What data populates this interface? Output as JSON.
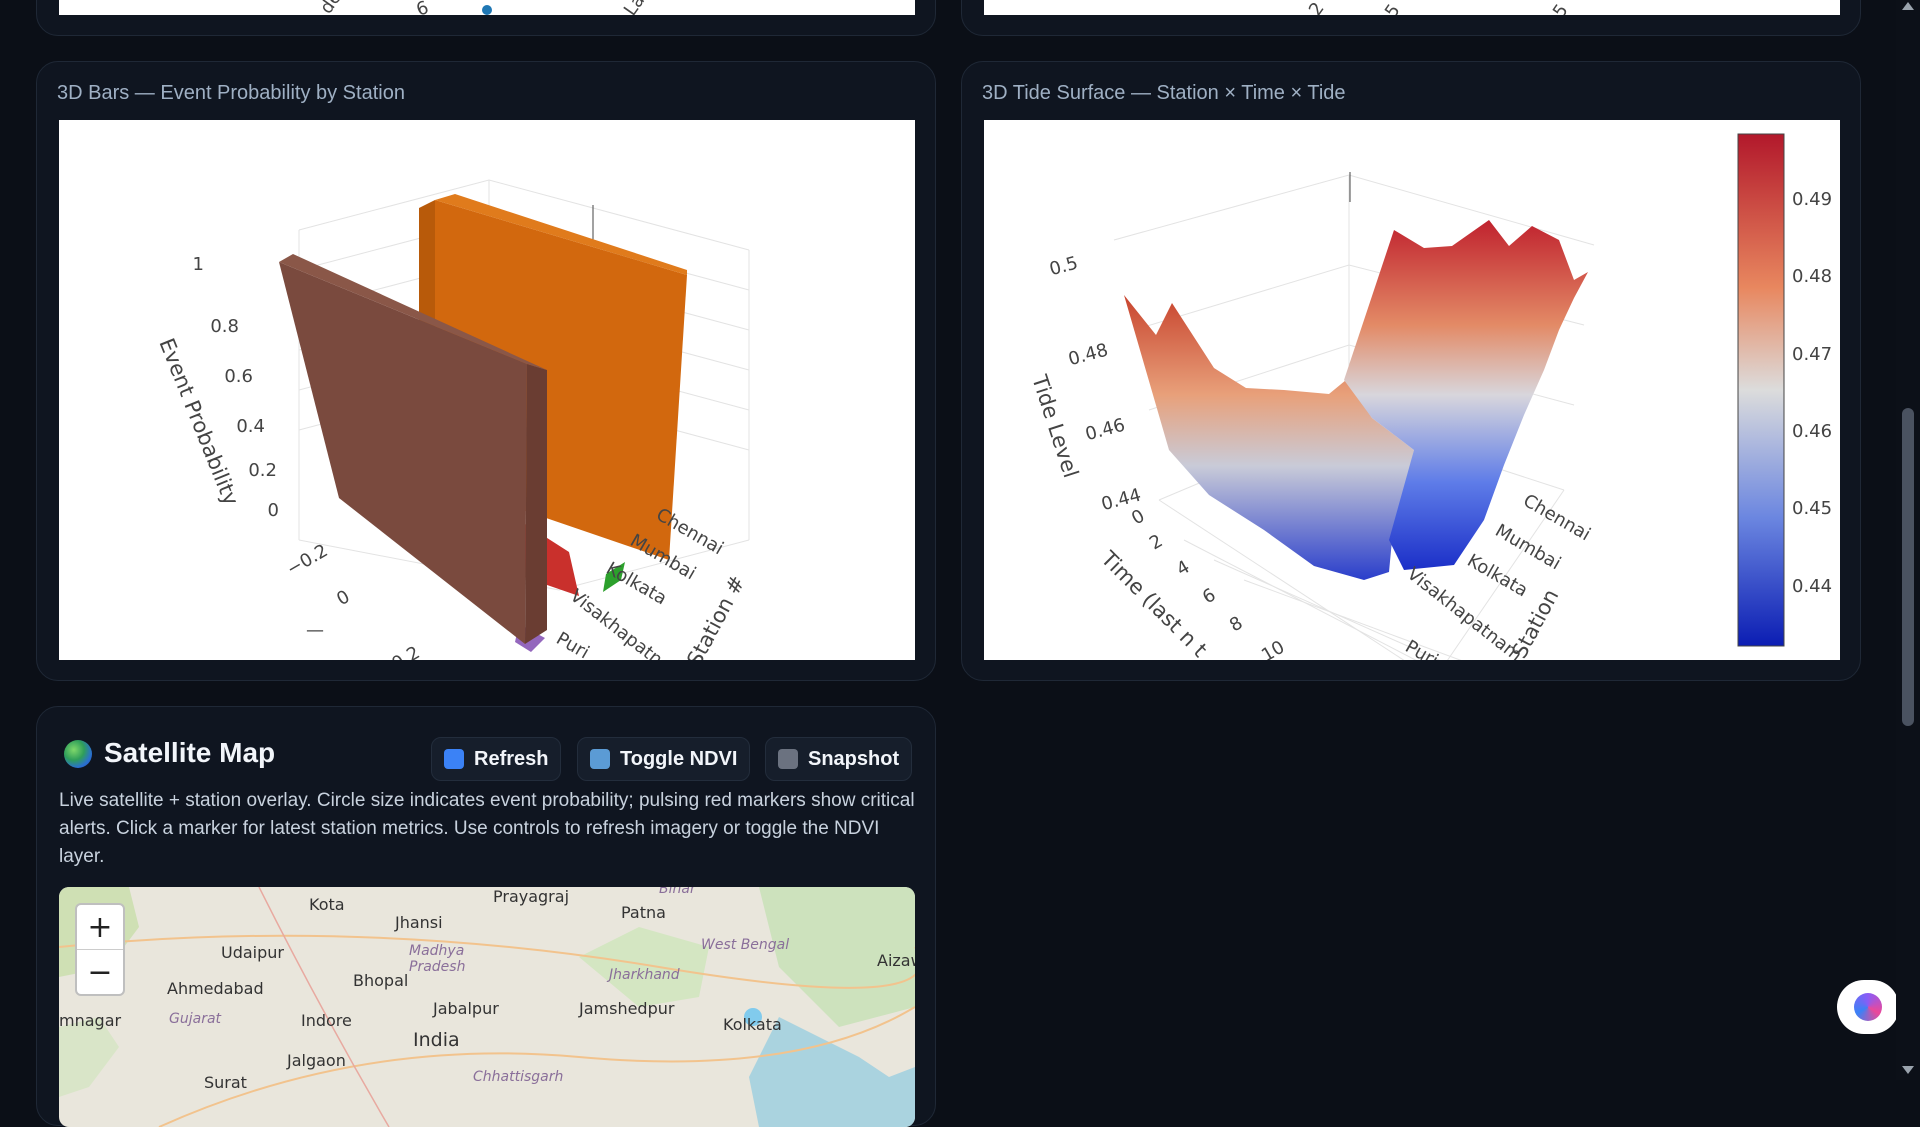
{
  "top_left_card": {
    "tick_a": "6",
    "tick_b": "La",
    "tick_c": "de"
  },
  "top_right_card": {
    "tick_a": "5",
    "tick_b": "2",
    "tick_c": "5"
  },
  "bar_card": {
    "title": "3D Bars — Event Probability by Station",
    "zaxis_label": "Event Probability",
    "zaxis_ticks": [
      "1",
      "0.8",
      "0.6",
      "0.4",
      "0.2",
      "0",
      "−0.2"
    ],
    "xaxis_ticks": [
      "0",
      "0.2"
    ],
    "xaxis_minor": "—",
    "yaxis_label": "Station #",
    "stations": [
      "Chennai",
      "Mumbai",
      "Kolkata",
      "Visakhapatnam",
      "Puri"
    ],
    "chart_data": {
      "type": "bar",
      "categories": [
        "Chennai",
        "Mumbai",
        "Kolkata",
        "Visakhapatnam",
        "Puri"
      ],
      "values": [
        0.05,
        1.0,
        0.05,
        0.2,
        0.05
      ],
      "colors": [
        "#1f77b4",
        "#d2680e",
        "#2ca02c",
        "#c9302c",
        "#9467bd"
      ],
      "ylabel": "Event Probability",
      "zlim": [
        -0.2,
        1
      ]
    },
    "brown_bar_value": 1.0,
    "brown_bar_color": "#7a4a3e"
  },
  "surface_card": {
    "title": "3D Tide Surface — Station × Time × Tide",
    "zaxis_label": "Tide Level",
    "zaxis_ticks": [
      "0.5",
      "0.48",
      "0.46",
      "0.44"
    ],
    "time_label": "Time (last n t",
    "time_ticks": [
      "0",
      "2",
      "4",
      "6",
      "8",
      "10"
    ],
    "station_label": "Station",
    "stations": [
      "Chennai",
      "Mumbai",
      "Kolkata",
      "Visakhapatnam",
      "Puri"
    ],
    "colorbar_ticks": [
      "0.49",
      "0.48",
      "0.47",
      "0.46",
      "0.45",
      "0.44"
    ],
    "chart_data": {
      "type": "heatmap",
      "colorscale": [
        "#0b1db3",
        "#ffffff",
        "#b2182b"
      ],
      "cmin": 0.435,
      "cmax": 0.498
    }
  },
  "map_card": {
    "title": "Satellite Map",
    "refresh_label": "Refresh",
    "ndvi_label": "Toggle NDVI",
    "snapshot_label": "Snapshot",
    "description": "Live satellite + station overlay. Circle size indicates event probability; pulsing red markers show critical alerts. Click a marker for latest station metrics. Use controls to refresh imagery or toggle the NDVI layer.",
    "zoom_in": "+",
    "zoom_out": "−",
    "places": [
      "Kota",
      "Prayagraj",
      "Bihar",
      "Jhansi",
      "Patna",
      "Udaipur",
      "Madhya Pradesh",
      "West Bengal",
      "Bhopal",
      "Ahmedabad",
      "Jharkhand",
      "Jamshedpur",
      "Gujarat",
      "Indore",
      "Jabalpur",
      "Kolkata",
      "India",
      "Jalgaon",
      "Chhattisgarh",
      "Aizaw",
      "mnagar",
      "Surat"
    ]
  }
}
